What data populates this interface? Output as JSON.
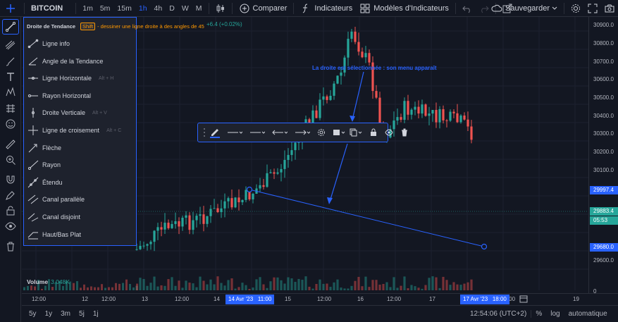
{
  "topbar": {
    "symbol": "BITCOIN",
    "timeframes": [
      "1m",
      "5m",
      "15m",
      "1h",
      "4h",
      "D",
      "W",
      "M"
    ],
    "active_timeframe": "1h",
    "compare_label": "Comparer",
    "indicators_label": "Indicateurs",
    "templates_label": "Modèles d'Indicateurs",
    "save_label": "Sauvegarder"
  },
  "tooltip": {
    "title": "Droite de Tendance",
    "key": "Shift",
    "hint": "- dessiner une ligne droite à des angles de 45"
  },
  "legend": {
    "change": "+6.4 (+0.02%)"
  },
  "drawing_menu": {
    "items": [
      {
        "label": "Ligne info",
        "hotkey": ""
      },
      {
        "label": "Angle de la Tendance",
        "hotkey": ""
      },
      {
        "label": "Ligne Horizontale",
        "hotkey": "Alt + H"
      },
      {
        "label": "Rayon Horizontal",
        "hotkey": ""
      },
      {
        "label": "Droite Verticale",
        "hotkey": "Alt + V"
      },
      {
        "label": "Ligne de croisement",
        "hotkey": "Alt + C"
      },
      {
        "label": "Flèche",
        "hotkey": ""
      },
      {
        "label": "Rayon",
        "hotkey": ""
      },
      {
        "label": "Étendu",
        "hotkey": ""
      },
      {
        "label": "Canal parallèle",
        "hotkey": ""
      },
      {
        "label": "Canal disjoint",
        "hotkey": ""
      },
      {
        "label": "Haut/Bas Plat",
        "hotkey": ""
      }
    ]
  },
  "annotation": "La droite est sélectionnée : son menu apparaît",
  "price_axis": {
    "labels": [
      "30900.0",
      "30800.0",
      "30700.0",
      "30600.0",
      "30500.0",
      "30400.0",
      "30300.0",
      "30200.0",
      "30100.0",
      "29600.0"
    ],
    "tag_high": "29997.4",
    "tag_last": "29883.4",
    "tag_countdown": "05:53",
    "tag_low": "29680.0",
    "zero": "0"
  },
  "time_axis": {
    "labels": [
      "12:00",
      "12",
      "12:00",
      "13",
      "12:00",
      "14",
      "15",
      "12:00",
      "16",
      "12:00",
      "17",
      "12:00",
      "19"
    ],
    "tag_start": "14 Avr '23",
    "tag_start_time": "11:00",
    "tag_end": "17 Avr '23",
    "tag_end_time": "18:00"
  },
  "volume": {
    "label": "Volume",
    "value": "3.048K"
  },
  "bottombar": {
    "ranges": [
      "5y",
      "1y",
      "3m",
      "5j",
      "1j"
    ],
    "clock": "12:54:06 (UTC+2)",
    "percent": "%",
    "log": "log",
    "auto": "automatique"
  },
  "colors": {
    "up": "#26a69a",
    "down": "#ef5350",
    "accent": "#2962ff",
    "background": "#131722"
  }
}
